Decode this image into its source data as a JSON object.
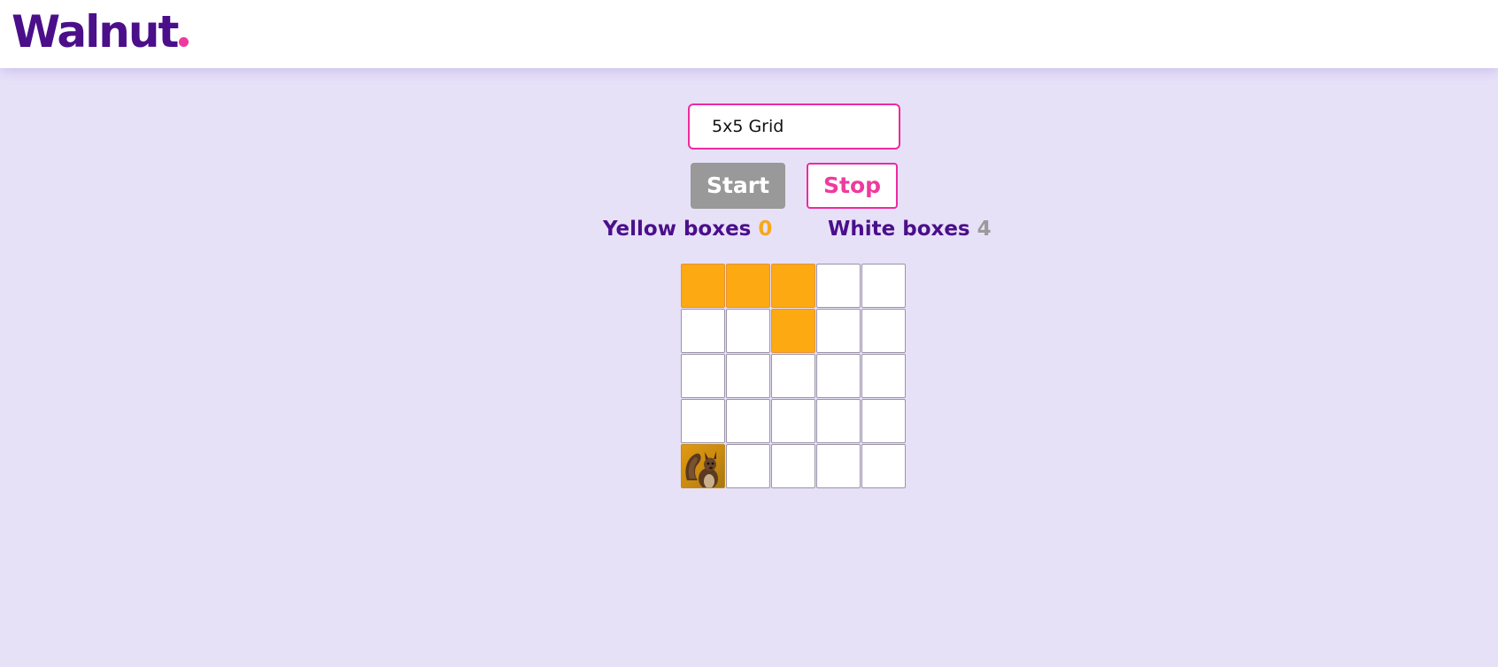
{
  "header": {
    "logo_text": "Walnut",
    "logo_dot_color": "#ee3a9e",
    "brand_color": "#4b0f8a"
  },
  "controls": {
    "grid_select_value": "5x5 Grid",
    "start_label": "Start",
    "stop_label": "Stop"
  },
  "counters": {
    "yellow_label": "Yellow boxes",
    "yellow_count": "0",
    "white_label": "White boxes",
    "white_count": "4"
  },
  "board": {
    "rows": 5,
    "cols": 5,
    "cells": [
      [
        "yellow",
        "yellow",
        "yellow",
        "white",
        "white"
      ],
      [
        "white",
        "white",
        "yellow",
        "white",
        "white"
      ],
      [
        "white",
        "white",
        "white",
        "white",
        "white"
      ],
      [
        "white",
        "white",
        "white",
        "white",
        "white"
      ],
      [
        "squirrel",
        "white",
        "white",
        "white",
        "white"
      ]
    ],
    "colors": {
      "yellow": "#fca912",
      "white": "#ffffff"
    }
  }
}
